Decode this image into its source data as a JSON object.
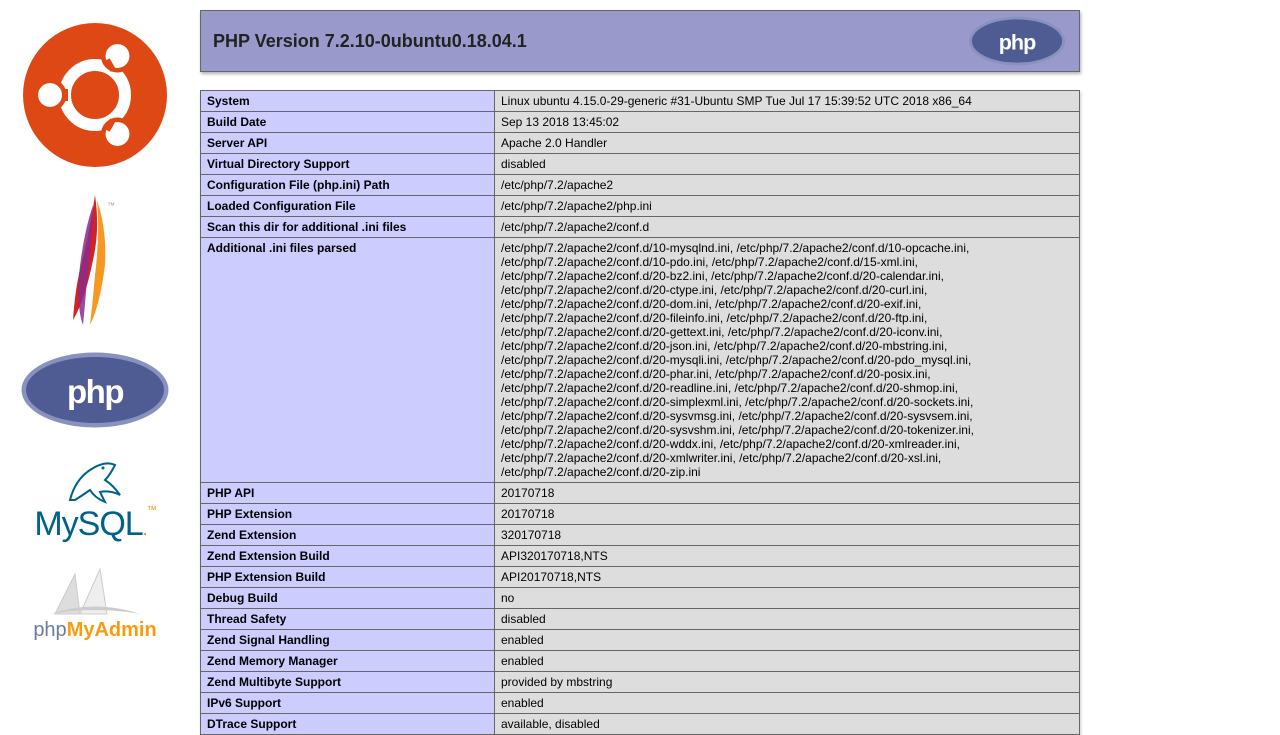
{
  "header": {
    "title": "PHP Version 7.2.10-0ubuntu0.18.04.1"
  },
  "rows": [
    {
      "k": "System",
      "v": "Linux ubuntu 4.15.0-29-generic #31-Ubuntu SMP Tue Jul 17 15:39:52 UTC 2018 x86_64"
    },
    {
      "k": "Build Date",
      "v": "Sep 13 2018 13:45:02"
    },
    {
      "k": "Server API",
      "v": "Apache 2.0 Handler"
    },
    {
      "k": "Virtual Directory Support",
      "v": "disabled"
    },
    {
      "k": "Configuration File (php.ini) Path",
      "v": "/etc/php/7.2/apache2"
    },
    {
      "k": "Loaded Configuration File",
      "v": "/etc/php/7.2/apache2/php.ini"
    },
    {
      "k": "Scan this dir for additional .ini files",
      "v": "/etc/php/7.2/apache2/conf.d"
    },
    {
      "k": "Additional .ini files parsed",
      "v": "/etc/php/7.2/apache2/conf.d/10-mysqlnd.ini, /etc/php/7.2/apache2/conf.d/10-opcache.ini, /etc/php/7.2/apache2/conf.d/10-pdo.ini, /etc/php/7.2/apache2/conf.d/15-xml.ini, /etc/php/7.2/apache2/conf.d/20-bz2.ini, /etc/php/7.2/apache2/conf.d/20-calendar.ini, /etc/php/7.2/apache2/conf.d/20-ctype.ini, /etc/php/7.2/apache2/conf.d/20-curl.ini, /etc/php/7.2/apache2/conf.d/20-dom.ini, /etc/php/7.2/apache2/conf.d/20-exif.ini, /etc/php/7.2/apache2/conf.d/20-fileinfo.ini, /etc/php/7.2/apache2/conf.d/20-ftp.ini, /etc/php/7.2/apache2/conf.d/20-gettext.ini, /etc/php/7.2/apache2/conf.d/20-iconv.ini, /etc/php/7.2/apache2/conf.d/20-json.ini, /etc/php/7.2/apache2/conf.d/20-mbstring.ini, /etc/php/7.2/apache2/conf.d/20-mysqli.ini, /etc/php/7.2/apache2/conf.d/20-pdo_mysql.ini, /etc/php/7.2/apache2/conf.d/20-phar.ini, /etc/php/7.2/apache2/conf.d/20-posix.ini, /etc/php/7.2/apache2/conf.d/20-readline.ini, /etc/php/7.2/apache2/conf.d/20-shmop.ini, /etc/php/7.2/apache2/conf.d/20-simplexml.ini, /etc/php/7.2/apache2/conf.d/20-sockets.ini, /etc/php/7.2/apache2/conf.d/20-sysvmsg.ini, /etc/php/7.2/apache2/conf.d/20-sysvsem.ini, /etc/php/7.2/apache2/conf.d/20-sysvshm.ini, /etc/php/7.2/apache2/conf.d/20-tokenizer.ini, /etc/php/7.2/apache2/conf.d/20-wddx.ini, /etc/php/7.2/apache2/conf.d/20-xmlreader.ini, /etc/php/7.2/apache2/conf.d/20-xmlwriter.ini, /etc/php/7.2/apache2/conf.d/20-xsl.ini, /etc/php/7.2/apache2/conf.d/20-zip.ini"
    },
    {
      "k": "PHP API",
      "v": "20170718"
    },
    {
      "k": "PHP Extension",
      "v": "20170718"
    },
    {
      "k": "Zend Extension",
      "v": "320170718"
    },
    {
      "k": "Zend Extension Build",
      "v": "API320170718,NTS"
    },
    {
      "k": "PHP Extension Build",
      "v": "API20170718,NTS"
    },
    {
      "k": "Debug Build",
      "v": "no"
    },
    {
      "k": "Thread Safety",
      "v": "disabled"
    },
    {
      "k": "Zend Signal Handling",
      "v": "enabled"
    },
    {
      "k": "Zend Memory Manager",
      "v": "enabled"
    },
    {
      "k": "Zend Multibyte Support",
      "v": "provided by mbstring"
    },
    {
      "k": "IPv6 Support",
      "v": "enabled"
    },
    {
      "k": "DTrace Support",
      "v": "available, disabled"
    }
  ],
  "sidebar": {
    "mysql": "MySQL",
    "pma1": "php",
    "pma2": "MyAdmin"
  }
}
